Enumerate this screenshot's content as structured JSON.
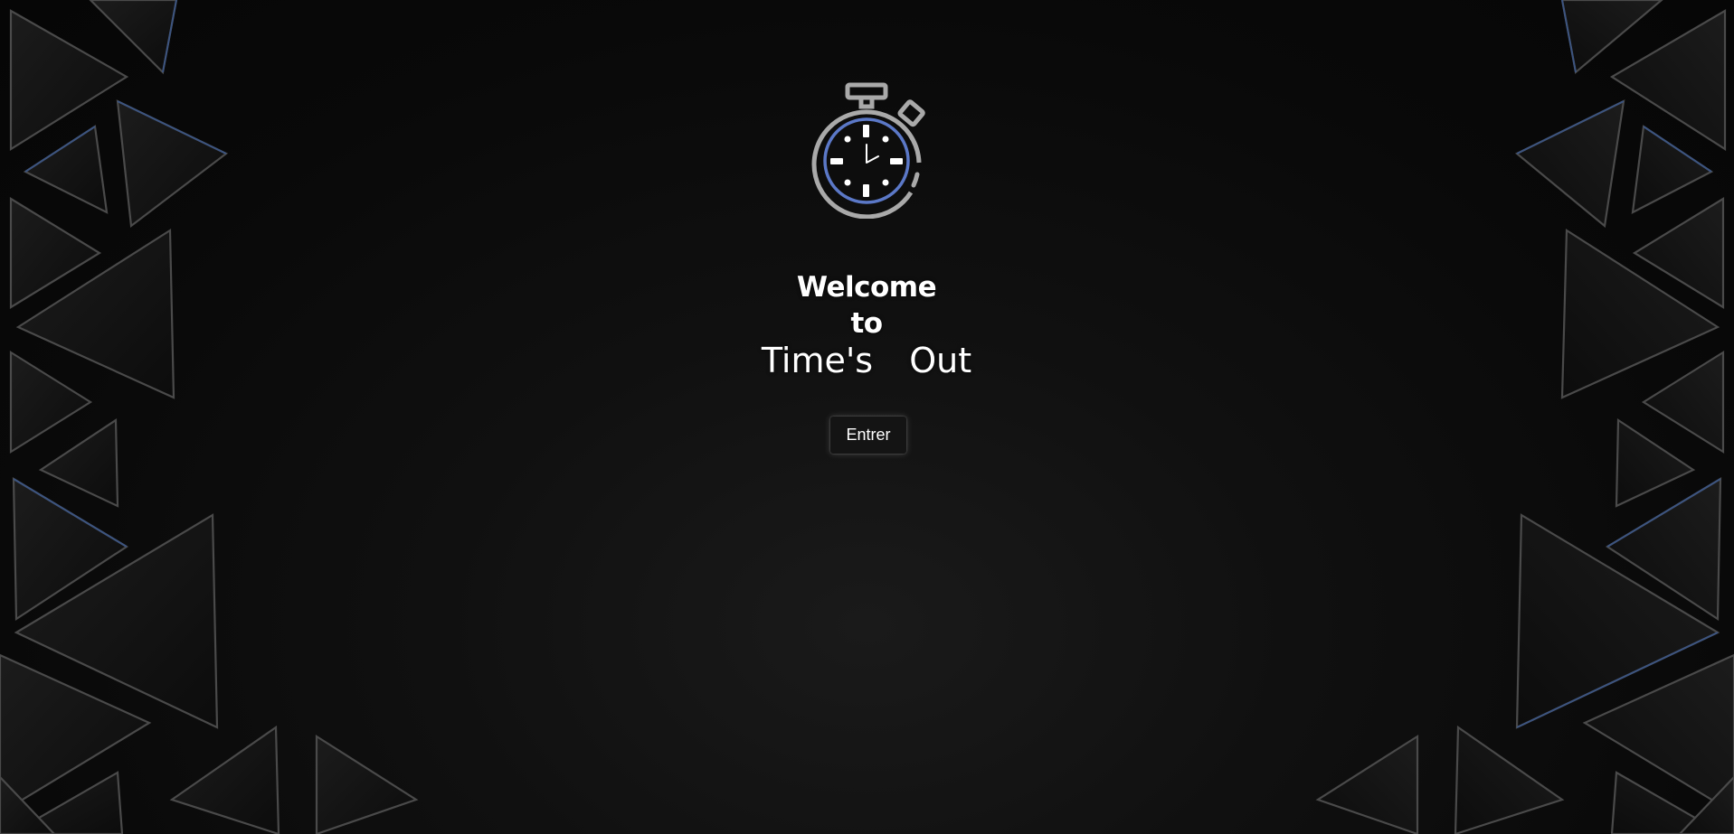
{
  "welcome": {
    "line1": "Welcome",
    "line2": "to",
    "line3": "Time's  Out"
  },
  "actions": {
    "enter_label": "Entrer"
  },
  "icons": {
    "logo": "stopwatch-icon",
    "background": "triangle-pattern"
  },
  "colors": {
    "background": "#0b0b0b",
    "text": "#ffffff",
    "accent": "#5b78c7",
    "icon_stroke": "#a9a9a9",
    "triangle_edge": "#3a3a3a",
    "triangle_edge_blue": "#3c5480"
  }
}
